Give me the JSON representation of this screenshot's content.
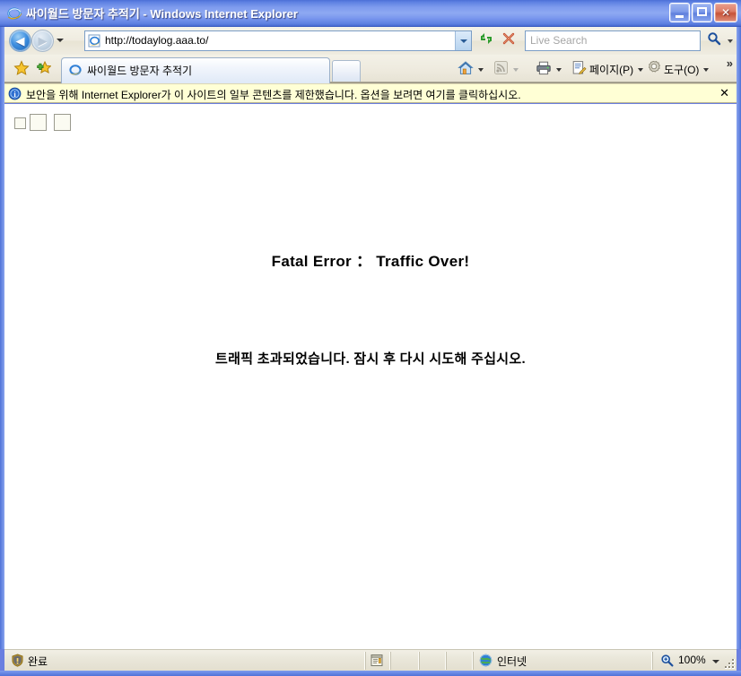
{
  "window": {
    "title": "싸이월드 방문자 추적기 - Windows Internet Explorer",
    "minimize_label": "최소화",
    "maximize_label": "최대화",
    "close_label": "닫기"
  },
  "navigation": {
    "back_label": "뒤로",
    "forward_label": "앞으로",
    "recent_pages_label": "최근 페이지",
    "url": "http://todaylog.aaa.to/",
    "refresh_label": "새로 고침",
    "stop_label": "중지"
  },
  "search": {
    "placeholder": "Live Search",
    "value": "",
    "go_label": "검색",
    "options_label": "검색 옵션"
  },
  "favorites": {
    "center_label": "즐겨찾기 센터",
    "add_label": "즐겨찾기에 추가"
  },
  "tabs": {
    "items": [
      {
        "label": "싸이월드 방문자 추적기",
        "active": true
      }
    ],
    "new_tab_label": "새 탭"
  },
  "command_bar": {
    "home_label": "홈",
    "feeds_label": "피드",
    "print_label": "인쇄",
    "page_label": "페이지(P)",
    "tools_label": "도구(O)",
    "overflow_label": "»"
  },
  "info_bar": {
    "message": "보안을 위해 Internet Explorer가 이 사이트의 일부 콘텐츠를 제한했습니다. 옵션을 보려면 여기를 클릭하십시오.",
    "close_label": "✕"
  },
  "page": {
    "broken_images": [
      {
        "name": "broken-image-small"
      },
      {
        "name": "broken-image-medium"
      },
      {
        "name": "broken-image-large"
      }
    ],
    "error_title": "Fatal Error ： Traffic Over!",
    "error_message": "트래픽 초과되었습니다. 잠시 후 다시 시도해 주십시오."
  },
  "status_bar": {
    "status_text": "완료",
    "zone_text": "인터넷",
    "zoom_level": "100%"
  },
  "colors": {
    "titlebar_blue": "#7e9bee",
    "toolbar_beige": "#eeeade",
    "infobar_yellow": "#ffffd5",
    "content_white": "#ffffff",
    "frame_blue": "#4f72d8"
  }
}
